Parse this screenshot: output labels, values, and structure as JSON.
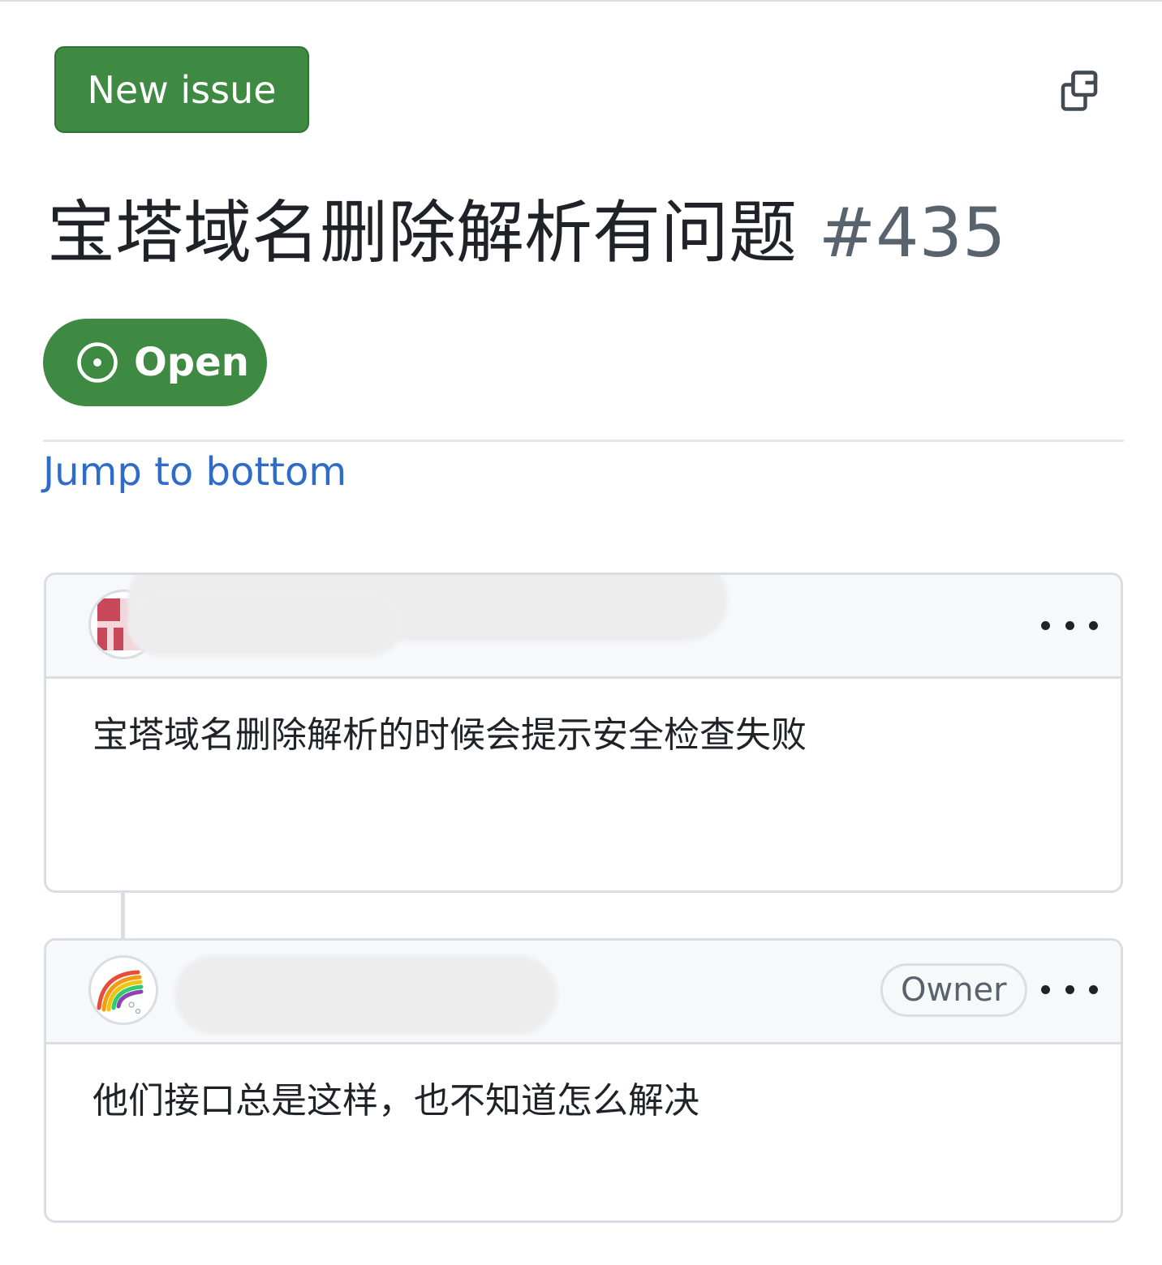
{
  "header": {
    "new_issue_label": "New issue",
    "copy_icon": "copy-icon"
  },
  "issue": {
    "title": "宝塔域名删除解析有问题",
    "number": "#435",
    "state": "Open",
    "state_icon": "issue-opened-icon"
  },
  "nav": {
    "jump_label": "Jump to bottom"
  },
  "comments": [
    {
      "author": "",
      "meta": "",
      "badge": "",
      "body": "宝塔域名删除解析的时候会提示安全检查失败"
    },
    {
      "author": "",
      "meta": "",
      "badge": "Owner",
      "body": "他们接口总是这样，也不知道怎么解决"
    }
  ],
  "colors": {
    "primary_green": "#3e8a42",
    "link_blue": "#2f6bc9",
    "border": "#d8dee4",
    "header_bg": "#f6f8fa",
    "muted_text": "#59636e"
  }
}
